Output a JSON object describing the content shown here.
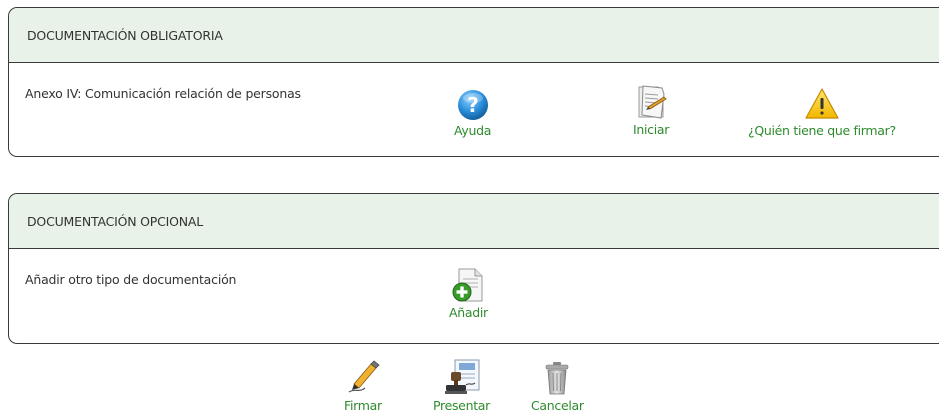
{
  "mandatory": {
    "title": "DOCUMENTACIÓN OBLIGATORIA",
    "row_label": "Anexo IV: Comunicación relación de personas",
    "actions": {
      "help": "Ayuda",
      "start": "Iniciar",
      "who_signs": "¿Quién tiene que firmar?"
    }
  },
  "optional": {
    "title": "DOCUMENTACIÓN OPCIONAL",
    "row_label": "Añadir otro tipo de documentación",
    "actions": {
      "add": "Añadir"
    }
  },
  "footer": {
    "sign": "Firmar",
    "submit": "Presentar",
    "cancel": "Cancelar"
  },
  "colors": {
    "header_bg": "#e8f2e8",
    "link": "#2e8b2e",
    "border": "#3a3a3a"
  },
  "icons": {
    "help": "question-icon",
    "start": "document-edit-icon",
    "who_signs": "warning-icon",
    "add": "add-document-icon",
    "sign": "pen-icon",
    "submit": "stamp-icon",
    "cancel": "trash-icon"
  }
}
